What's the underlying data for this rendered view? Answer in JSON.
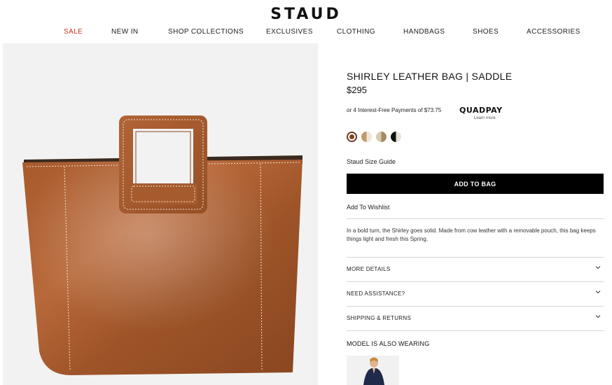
{
  "header": {
    "logo": "STAUD",
    "nav": [
      "SALE",
      "NEW IN",
      "SHOP COLLECTIONS",
      "EXCLUSIVES",
      "CLOTHING",
      "HANDBAGS",
      "SHOES",
      "ACCESSORIES"
    ]
  },
  "product": {
    "title": "SHIRLEY LEATHER BAG | SADDLE",
    "price": "$295",
    "installments": "or 4 Interest-Free Payments of $73.75",
    "quadpay_logo": "QUADPAY",
    "quadpay_link": "Learn more",
    "swatches": [
      {
        "name": "saddle",
        "color": "#7a4426",
        "selected": true
      },
      {
        "name": "tan-cream",
        "color": "#c19a6b"
      },
      {
        "name": "cream-tan",
        "color": "#d9cbb3"
      },
      {
        "name": "black-cream",
        "color": "#111111"
      }
    ],
    "size_guide": "Staud Size Guide",
    "add_to_bag": "ADD TO BAG",
    "wishlist": "Add To Wishlist",
    "description": "In a bold turn, the Shirley goes solid. Made from cow leather with a removable pouch, this bag keeps things light and fresh this Spring.",
    "accordions": [
      "MORE DETAILS",
      "NEED ASSISTANCE?",
      "SHIPPING & RETURNS"
    ],
    "model_heading": "MODEL IS ALSO WEARING"
  },
  "colors": {
    "sale": "#c8321e",
    "leather": "#a35a2e",
    "button": "#000000"
  }
}
